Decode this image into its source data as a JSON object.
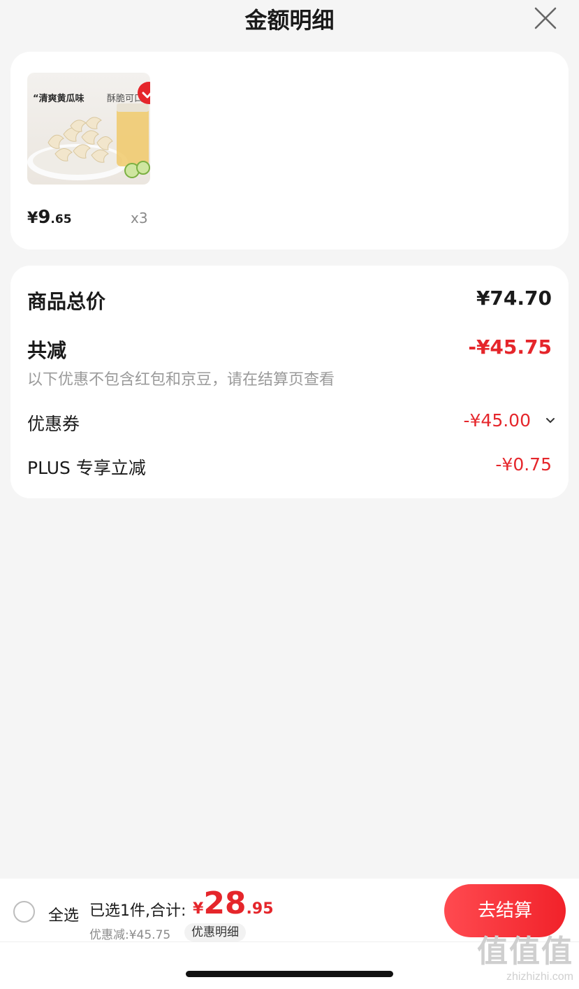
{
  "header": {
    "title": "金额明细",
    "close_icon": "close-icon"
  },
  "product": {
    "image_text_1": "“清爽黄瓜味",
    "image_text_2": "酥脆可口",
    "price_yen": "¥",
    "price_int": "9",
    "price_dec": ".65",
    "quantity": "x3",
    "selected": true
  },
  "summary": {
    "goods_total_label": "商品总价",
    "goods_total_value": "¥74.70",
    "total_discount_label": "共减",
    "total_discount_value": "-¥45.75",
    "note": "以下优惠不包含红包和京豆，请在结算页查看",
    "coupon_label": "优惠券",
    "coupon_value": "-¥45.00",
    "plus_label": "PLUS 专享立减",
    "plus_value": "-¥0.75"
  },
  "bottom": {
    "select_all": "全选",
    "selected_text": "已选1件,合计:",
    "total_yen": "¥",
    "total_int": "28",
    "total_dec": ".95",
    "discount_text": "优惠减:¥45.75",
    "detail_button": "优惠明细",
    "checkout_button": "去结算"
  },
  "watermark": {
    "big": "值值值",
    "small": "zhizhizhi.com"
  },
  "colors": {
    "accent": "#e5262b",
    "background": "#f5f5f5",
    "card": "#ffffff"
  }
}
